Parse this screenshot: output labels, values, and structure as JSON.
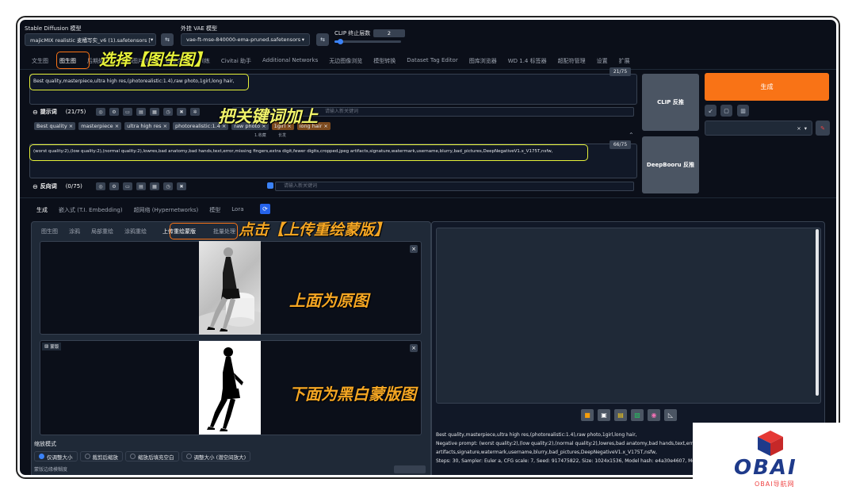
{
  "top": {
    "sd_model_label": "Stable Diffusion 模型",
    "sd_model_value": "majicMIX realistic 麦橘写实_v6 (1).safetensors [",
    "vae_label": "外挂 VAE 模型",
    "vae_value": "vae-ft-mse-840000-ema-pruned.safetensors",
    "clip_label": "CLIP 终止层数",
    "clip_value": "2",
    "clip_fraction": 0.08
  },
  "main_tabs": [
    "文生图",
    "图生图",
    "后期处理",
    "PNG图片信息",
    "模型合并",
    "训练",
    "Civitai 助手",
    "Additional Networks",
    "无边图像浏览",
    "模型转换",
    "Dataset Tag Editor",
    "图库浏览器",
    "WD 1.4 标签器",
    "超配符管理",
    "设置",
    "扩展"
  ],
  "prompt": {
    "text": "Best quality,masterpiece,ultra high res,(photorealistic:1.4),raw photo,1girl,long hair,",
    "counter": "21/75",
    "label": "提示词",
    "count": "(21/75)",
    "keyword_placeholder": "请输入新关键词",
    "tags": [
      "Best quality",
      "masterpiece",
      "ultra high res",
      "photorealistic:1.4",
      "raw photo",
      "1girl",
      "long hair"
    ],
    "tag_sub1": "1.收藏",
    "tag_sub2": "长发"
  },
  "negative": {
    "text": "(worst quality:2),(low quality:2),(normal quality:2),lowres,bad anatomy,bad hands,text,error,missing fingers,extra digit,fewer digits,cropped,jpeg artifacts,signature,watermark,username,blurry,bad_pictures,DeepNegativeV1.x_V175T,nsfw,",
    "counter": "66/75",
    "label": "反向词",
    "count": "(0/75)",
    "keyword_placeholder": "请输入新关键词"
  },
  "right": {
    "generate": "生成",
    "clip_interrogate": "CLIP 反推",
    "deepbooru": "DeepBooru 反推"
  },
  "sub_tabs": [
    "生成",
    "嵌入式 (T.I. Embedding)",
    "超网络 (Hypernetworks)",
    "模型",
    "Lora"
  ],
  "img_tabs": [
    "图生图",
    "涂鸦",
    "局部重绘",
    "涂鸦重绘",
    "上传重绘蒙版",
    "批量处理"
  ],
  "mask_label": "蒙版",
  "resize": {
    "label": "缩放模式",
    "options": [
      "仅调整大小",
      "裁剪后缩放",
      "缩放后填充空白",
      "调整大小 (潜空间放大)"
    ],
    "next_label": "蒙版边缘模糊度"
  },
  "output_info": {
    "line1": "Best quality,masterpiece,ultra high res,(photorealistic:1.4),raw photo,1girl,long hair,",
    "line2": "Negative prompt: (worst quality:2),(low quality:2),(normal quality:2),lowres,bad anatomy,bad hands,text,error,mis",
    "line3": "artifacts,signature,watermark,username,blurry,bad_pictures,DeepNegativeV1.x_V175T,nsfw,",
    "line4": "Steps: 30, Sampler: Euler a, CFG scale: 7, Seed: 917475822, Size: 1024x1536, Model hash: e4a30e4607, Model: majic"
  },
  "annotations": {
    "a1": "选择【图生图】",
    "a2": "把关键词加上",
    "a3": "点击【上传重绘蒙版】",
    "a4": "上面为原图",
    "a5": "下面为黑白蒙版图"
  },
  "watermark": {
    "text": "OBAI",
    "sub": "OBAI导航网"
  },
  "colors": {
    "accent": "#f97316",
    "highlight": "#e7f23a",
    "bg": "#0b0f19"
  }
}
